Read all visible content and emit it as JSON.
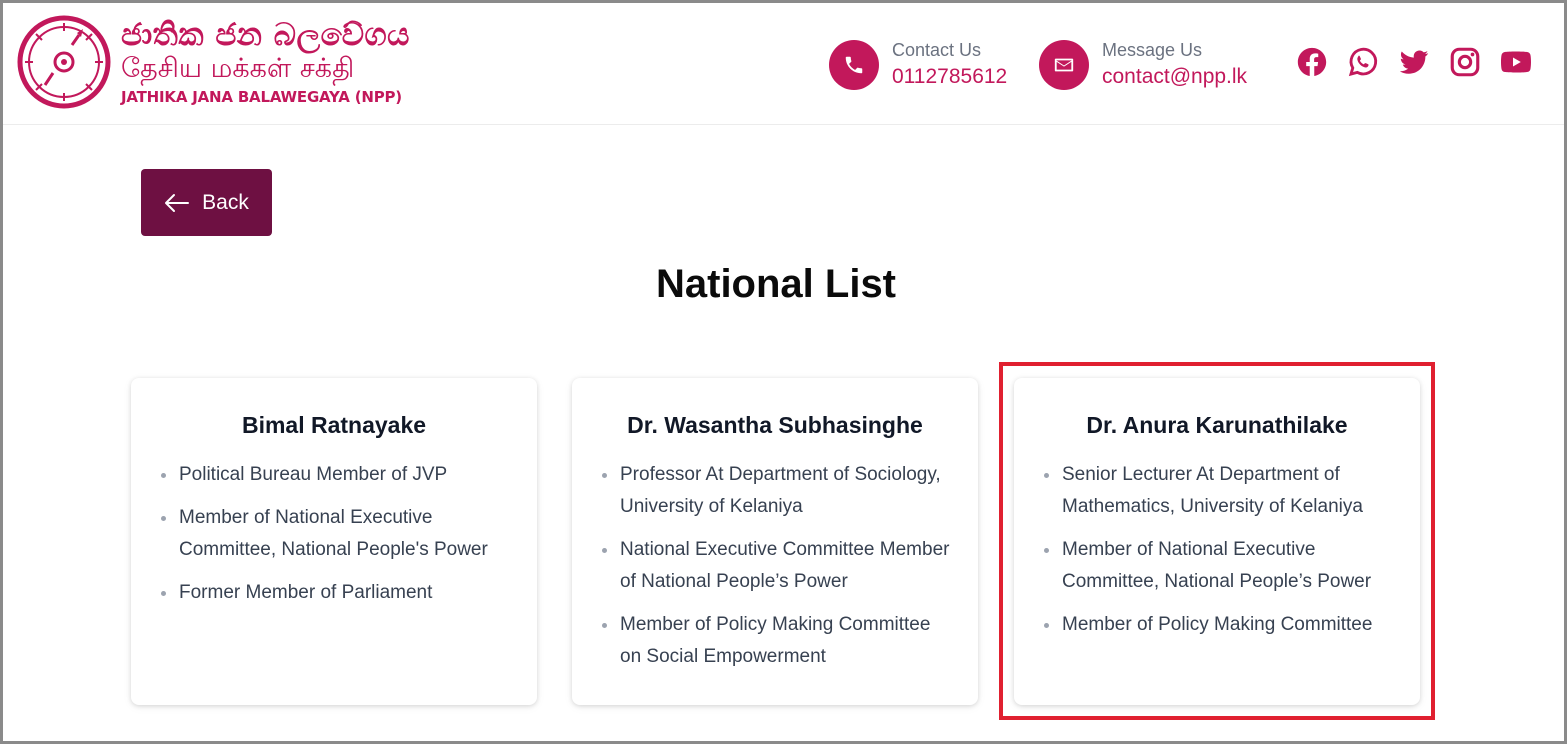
{
  "header": {
    "logo": {
      "sinhala": "ජාතික ජන බලවේගය",
      "tamil": "தேசிய மக்கள் சக்தி",
      "english": "JATHIKA JANA BALAWEGAYA (NPP)"
    },
    "contact": {
      "label": "Contact Us",
      "value": "0112785612"
    },
    "message": {
      "label": "Message Us",
      "value": "contact@npp.lk"
    },
    "socials": [
      "facebook-icon",
      "whatsapp-icon",
      "twitter-icon",
      "instagram-icon",
      "youtube-icon"
    ],
    "brand_color": "#c2185b"
  },
  "back_button": {
    "label": "Back",
    "color": "#6e1042"
  },
  "page_title": "National List",
  "cards": [
    {
      "name": "Bimal Ratnayake",
      "items": [
        "Political Bureau Member of JVP",
        "Member of National Executive Committee, National People's Power",
        "Former Member of Parliament"
      ]
    },
    {
      "name": "Dr. Wasantha Subhasinghe",
      "items": [
        "Professor At Department of Sociology, University of Kelaniya",
        "National Executive Committee Member of National People’s Power",
        "Member of Policy Making Committee on Social Empowerment"
      ]
    },
    {
      "name": "Dr. Anura Karunathilake",
      "items": [
        "Senior Lecturer At Department of Mathematics, University of Kelaniya",
        "Member of National Executive Committee, National People’s Power",
        "Member of Policy Making Committee"
      ]
    }
  ],
  "highlight_color": "#e02030"
}
